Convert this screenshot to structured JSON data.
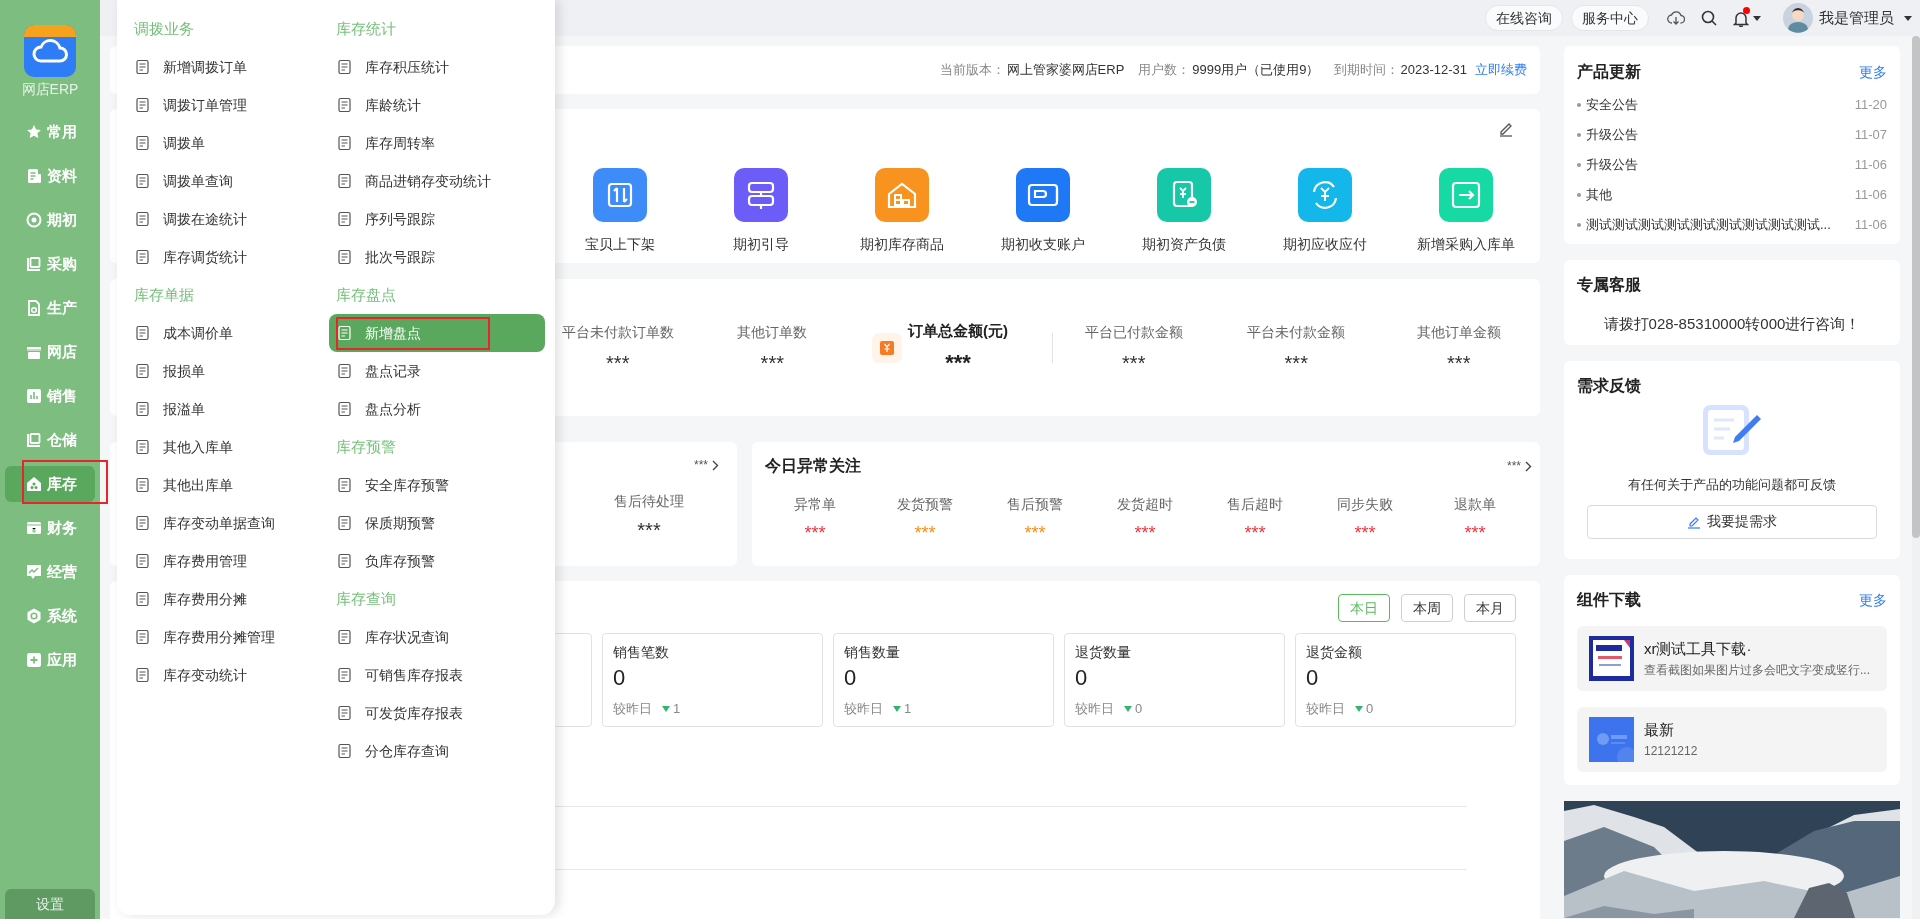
{
  "sidebar": {
    "product": "网店ERP",
    "items": [
      {
        "label": "常用",
        "selected": false
      },
      {
        "label": "资料",
        "selected": false
      },
      {
        "label": "期初",
        "selected": false
      },
      {
        "label": "采购",
        "selected": false
      },
      {
        "label": "生产",
        "selected": false
      },
      {
        "label": "网店",
        "selected": false
      },
      {
        "label": "销售",
        "selected": false
      },
      {
        "label": "仓储",
        "selected": false
      },
      {
        "label": "库存",
        "selected": true
      },
      {
        "label": "财务",
        "selected": false
      },
      {
        "label": "经营",
        "selected": false
      },
      {
        "label": "系统",
        "selected": false
      },
      {
        "label": "应用",
        "selected": false
      }
    ],
    "settings": "设置"
  },
  "menu": {
    "columns": [
      [
        {
          "kind": "heading",
          "label": "调拨业务"
        },
        {
          "kind": "item",
          "label": "新增调拨订单",
          "selected": false
        },
        {
          "kind": "item",
          "label": "调拨订单管理",
          "selected": false
        },
        {
          "kind": "item",
          "label": "调拨单",
          "selected": false
        },
        {
          "kind": "item",
          "label": "调拨单查询",
          "selected": false
        },
        {
          "kind": "item",
          "label": "调拨在途统计",
          "selected": false
        },
        {
          "kind": "item",
          "label": "库存调货统计",
          "selected": false
        },
        {
          "kind": "heading",
          "label": "库存单据"
        },
        {
          "kind": "item",
          "label": "成本调价单",
          "selected": false
        },
        {
          "kind": "item",
          "label": "报损单",
          "selected": false
        },
        {
          "kind": "item",
          "label": "报溢单",
          "selected": false
        },
        {
          "kind": "item",
          "label": "其他入库单",
          "selected": false
        },
        {
          "kind": "item",
          "label": "其他出库单",
          "selected": false
        },
        {
          "kind": "item",
          "label": "库存变动单据查询",
          "selected": false
        },
        {
          "kind": "item",
          "label": "库存费用管理",
          "selected": false
        },
        {
          "kind": "item",
          "label": "库存费用分摊",
          "selected": false
        },
        {
          "kind": "item",
          "label": "库存费用分摊管理",
          "selected": false
        },
        {
          "kind": "item",
          "label": "库存变动统计",
          "selected": false
        }
      ],
      [
        {
          "kind": "heading",
          "label": "库存统计"
        },
        {
          "kind": "item",
          "label": "库存积压统计",
          "selected": false
        },
        {
          "kind": "item",
          "label": "库龄统计",
          "selected": false
        },
        {
          "kind": "item",
          "label": "库存周转率",
          "selected": false
        },
        {
          "kind": "item",
          "label": "商品进销存变动统计",
          "selected": false
        },
        {
          "kind": "item",
          "label": "序列号跟踪",
          "selected": false
        },
        {
          "kind": "item",
          "label": "批次号跟踪",
          "selected": false
        },
        {
          "kind": "heading",
          "label": "库存盘点"
        },
        {
          "kind": "item",
          "label": "新增盘点",
          "selected": true
        },
        {
          "kind": "item",
          "label": "盘点记录",
          "selected": false
        },
        {
          "kind": "item",
          "label": "盘点分析",
          "selected": false
        },
        {
          "kind": "heading",
          "label": "库存预警"
        },
        {
          "kind": "item",
          "label": "安全库存预警",
          "selected": false
        },
        {
          "kind": "item",
          "label": "保质期预警",
          "selected": false
        },
        {
          "kind": "item",
          "label": "负库存预警",
          "selected": false
        },
        {
          "kind": "heading",
          "label": "库存查询"
        },
        {
          "kind": "item",
          "label": "库存状况查询",
          "selected": false
        },
        {
          "kind": "item",
          "label": "可销售库存报表",
          "selected": false
        },
        {
          "kind": "item",
          "label": "可发货库存报表",
          "selected": false
        },
        {
          "kind": "item",
          "label": "分仓库存查询",
          "selected": false
        }
      ]
    ]
  },
  "topbar": {
    "buttons": [
      "在线咨询",
      "服务中心"
    ],
    "unread": true,
    "user": "我是管理员"
  },
  "version_bar": {
    "fields": [
      {
        "label": "当前版本：",
        "value": "网上管家婆网店ERP"
      },
      {
        "label": "用户数：",
        "value": "9999用户（已使用9）"
      },
      {
        "label": "到期时间：",
        "value": "2023-12-31"
      }
    ],
    "renew_link": "立即续费"
  },
  "shortcuts": [
    {
      "label": "宝贝上下架",
      "color": "#3e8bfa"
    },
    {
      "label": "期初引导",
      "color": "#6c5cf8"
    },
    {
      "label": "期初库存商品",
      "color": "#f7931e"
    },
    {
      "label": "期初收支账户",
      "color": "#1f78f5"
    },
    {
      "label": "期初资产负债",
      "color": "#16c7a8"
    },
    {
      "label": "期初应收应付",
      "color": "#14b7ea"
    },
    {
      "label": "新增采购入库单",
      "color": "#17d9a3"
    }
  ],
  "order_stats": {
    "left": [
      {
        "label": "平台未付款订单数",
        "value": "***"
      },
      {
        "label": "其他订单数",
        "value": "***"
      }
    ],
    "total": {
      "label": "订单总金额(元)",
      "value": "***"
    },
    "right": [
      {
        "label": "平台已付款金额",
        "value": "***"
      },
      {
        "label": "平台未付款金额",
        "value": "***"
      },
      {
        "label": "其他订单金额",
        "value": "***"
      }
    ]
  },
  "aftersale_card": {
    "more": "***",
    "stats": [
      {
        "label": "售后待处理",
        "value": "***"
      }
    ]
  },
  "anomaly_card": {
    "title": "今日异常关注",
    "more": "***",
    "stats": [
      {
        "label": "异常单",
        "value": "***",
        "color": "#f0323c"
      },
      {
        "label": "发货预警",
        "value": "***",
        "color": "#fa8c16"
      },
      {
        "label": "售后预警",
        "value": "***",
        "color": "#fa8c16"
      },
      {
        "label": "发货超时",
        "value": "***",
        "color": "#f0323c"
      },
      {
        "label": "售后超时",
        "value": "***",
        "color": "#f0323c"
      },
      {
        "label": "同步失败",
        "value": "***",
        "color": "#f0323c"
      },
      {
        "label": "退款单",
        "value": "***",
        "color": "#f0323c"
      }
    ]
  },
  "sales": {
    "periods": [
      {
        "label": "本日",
        "selected": true
      },
      {
        "label": "本周",
        "selected": false
      },
      {
        "label": "本月",
        "selected": false
      }
    ],
    "cards": [
      {
        "label": "销售笔数",
        "value": "0",
        "compare": "较昨日",
        "change": "1"
      },
      {
        "label": "销售数量",
        "value": "0",
        "compare": "较昨日",
        "change": "1"
      },
      {
        "label": "退货数量",
        "value": "0",
        "compare": "较昨日",
        "change": "0"
      },
      {
        "label": "退货金额",
        "value": "0",
        "compare": "较昨日",
        "change": "0"
      }
    ]
  },
  "updates": {
    "title": "产品更新",
    "more": "更多",
    "items": [
      {
        "text": "安全公告",
        "date": "11-20"
      },
      {
        "text": "升级公告",
        "date": "11-07"
      },
      {
        "text": "升级公告",
        "date": "11-06"
      },
      {
        "text": "其他",
        "date": "11-06"
      },
      {
        "text": "测试测试测试测试测试测试测试测试测试...",
        "date": "11-06"
      }
    ]
  },
  "service": {
    "title": "专属客服",
    "text": "请拨打028-85310000转000进行咨询！"
  },
  "feedback": {
    "title": "需求反馈",
    "text": "有任何关于产品的功能问题都可反馈",
    "button": "我要提需求"
  },
  "downloads": {
    "title": "组件下载",
    "more": "更多",
    "items": [
      {
        "title": "xr测试工具下载·",
        "desc": "查看截图如果图片过多会吧文字变成竖行..."
      },
      {
        "title": "最新",
        "desc": "12121212"
      }
    ]
  }
}
